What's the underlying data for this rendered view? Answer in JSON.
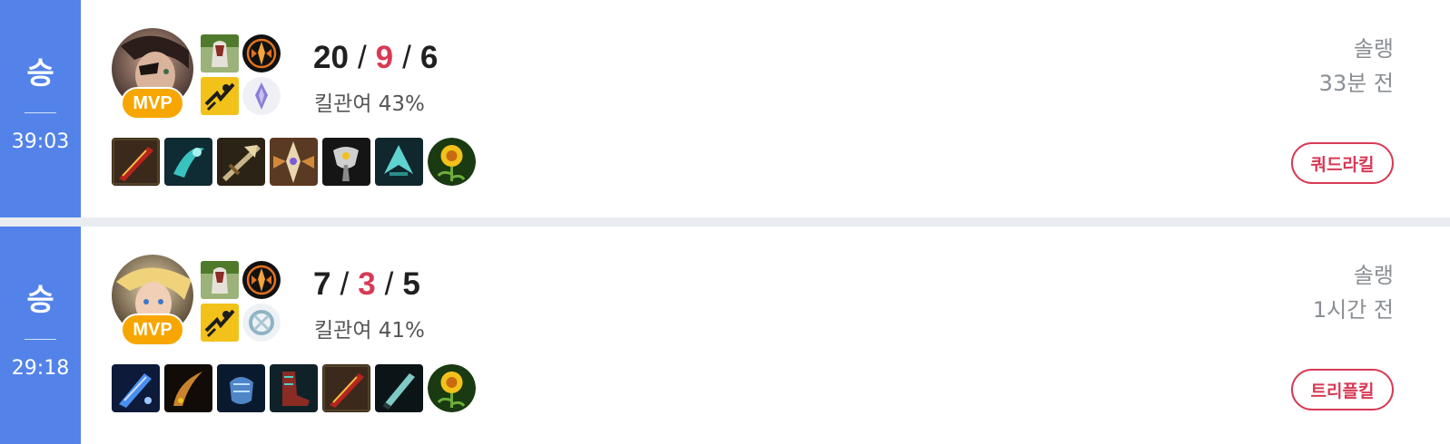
{
  "matches": [
    {
      "result": "승",
      "duration": "39:03",
      "champion_icon": "champion-portrait-icon",
      "badge": "MVP",
      "spells": [
        "ghost-spell-icon",
        "flash-spell-icon"
      ],
      "runes": [
        "keystone-rune-icon",
        "sorcery-rune-icon"
      ],
      "kda": {
        "kills": "20",
        "deaths": "9",
        "assists": "6",
        "sep": "/"
      },
      "kill_participation": "킬관여 43%",
      "items": [
        "rageblade-icon",
        "guinsoo-icon",
        "collector-icon",
        "runaans-icon",
        "infinity-edge-icon",
        "mercurial-icon"
      ],
      "trinket": "farsight-trinket-icon",
      "queue": "솔랭",
      "time_ago": "33분 전",
      "multikill": "쿼드라킬",
      "colors": {
        "result_bar": "#5383e8",
        "deaths": "#d73a55",
        "mvp": "#f7a600",
        "multikill": "#d73a55"
      }
    },
    {
      "result": "승",
      "duration": "29:18",
      "champion_icon": "champion-portrait-icon",
      "badge": "MVP",
      "spells": [
        "ghost-spell-icon",
        "flash-spell-icon"
      ],
      "runes": [
        "keystone-rune-icon",
        "precision-rune-icon"
      ],
      "kda": {
        "kills": "7",
        "deaths": "3",
        "assists": "5",
        "sep": "/"
      },
      "kill_participation": "킬관여 41%",
      "items": [
        "navori-icon",
        "scimitar-icon",
        "gauntlet-icon",
        "berserker-greaves-icon",
        "rageblade-icon",
        "blade-icon"
      ],
      "trinket": "farsight-trinket-icon",
      "queue": "솔랭",
      "time_ago": "1시간 전",
      "multikill": "트리플킬",
      "colors": {
        "result_bar": "#5383e8",
        "deaths": "#d73a55",
        "mvp": "#f7a600",
        "multikill": "#d73a55"
      }
    }
  ]
}
